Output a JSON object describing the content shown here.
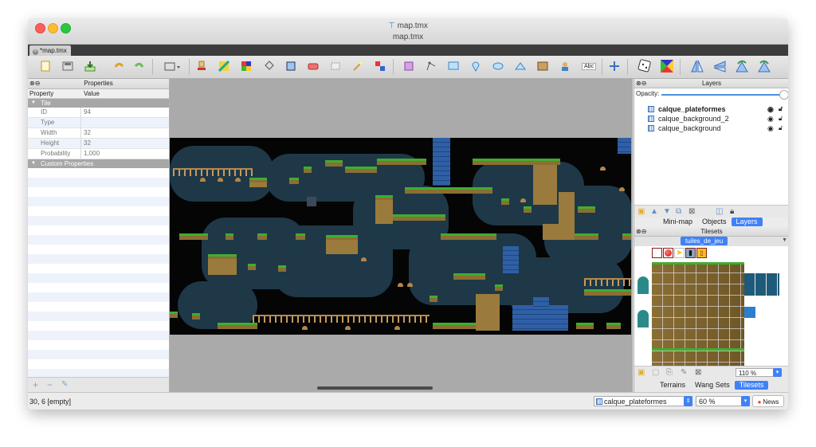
{
  "window": {
    "title_top": "map.tmx",
    "title_bottom": "map.tmx",
    "title_icon": "document-icon"
  },
  "tab": {
    "label": "*map.tmx"
  },
  "toolbar": {
    "icons": [
      "new-file-icon",
      "save-icon",
      "export-icon",
      "undo-icon",
      "redo-icon",
      "world-icon",
      "stamp-icon",
      "terrain-brush-icon",
      "wang-brush-icon",
      "bucket-fill-icon",
      "shape-fill-icon",
      "eraser-icon",
      "rect-select-icon",
      "magic-wand-icon",
      "select-same-icon",
      "object-select-icon",
      "edit-polygon-icon",
      "insert-rect-icon",
      "insert-point-icon",
      "insert-ellipse-icon",
      "insert-polygon-icon",
      "insert-tile-icon",
      "insert-template-icon",
      "insert-text-icon",
      "move-icon",
      "random-mode-icon",
      "wang-fill-icon",
      "flip-h-icon",
      "flip-v-icon",
      "rotate-left-icon",
      "rotate-right-icon"
    ],
    "text_icon_label": "Abc"
  },
  "properties": {
    "panel_title": "Properties",
    "col_property": "Property",
    "col_value": "Value",
    "group_tile": "Tile",
    "rows": [
      {
        "key": "ID",
        "value": "94"
      },
      {
        "key": "Type",
        "value": ""
      },
      {
        "key": "Width",
        "value": "32"
      },
      {
        "key": "Height",
        "value": "32"
      },
      {
        "key": "Probability",
        "value": "1,000"
      }
    ],
    "group_custom": "Custom Properties",
    "footer_add": "+",
    "footer_remove": "−",
    "footer_edit": "✎"
  },
  "layers": {
    "panel_title": "Layers",
    "opacity_label": "Opacity:",
    "opacity_value": 1.0,
    "items": [
      {
        "name": "calque_plateformes",
        "selected": true
      },
      {
        "name": "calque_background_2",
        "selected": false
      },
      {
        "name": "calque_background",
        "selected": false
      }
    ],
    "tabs": [
      "Mini-map",
      "Objects",
      "Layers"
    ],
    "active_tab": "Layers"
  },
  "tilesets": {
    "panel_title": "Tilesets",
    "tileset_name": "tuiles_de_jeu",
    "zoom": "110 %",
    "bottom_tabs": [
      "Terrains",
      "Wang Sets",
      "Tilesets"
    ],
    "active_tab": "Tilesets"
  },
  "status": {
    "coord": "30, 6 [empty]",
    "current_layer": "calque_plateformes",
    "zoom": "60 %",
    "news": "News"
  },
  "colors": {
    "accent": "#3f82f7",
    "map_background": "#050505",
    "cave": "#1e3848",
    "grass": "#3fae2e",
    "dirt": "#9a7b3d",
    "brick": "#2f5fa6"
  }
}
